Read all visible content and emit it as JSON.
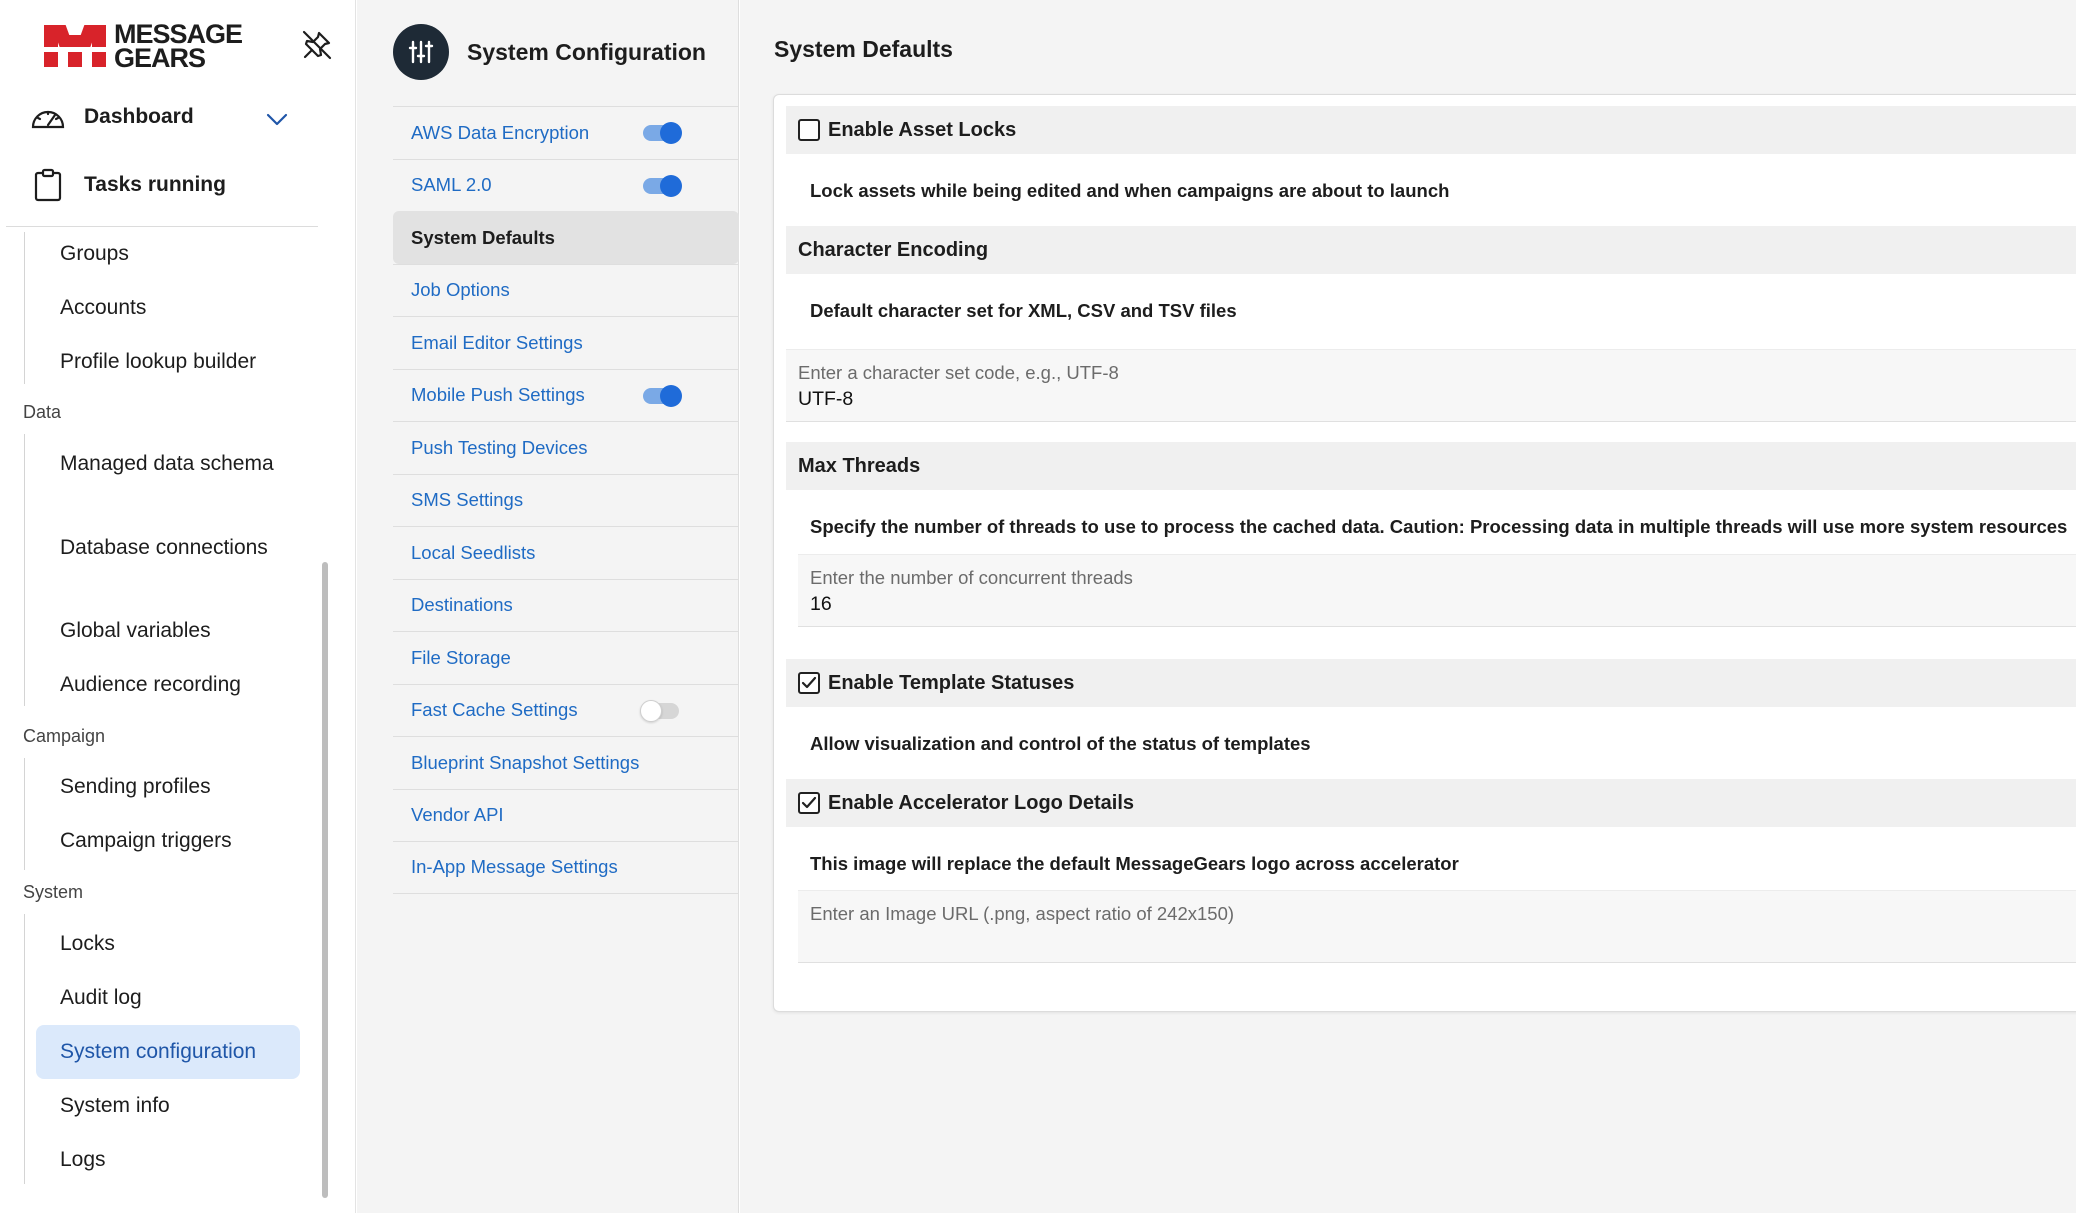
{
  "brand": {
    "line1": "MESSAGE",
    "line2": "GEARS",
    "color": "#d8232a"
  },
  "sidebar": {
    "dashboard_label": "Dashboard",
    "tasks_label": "Tasks running",
    "items_top": [
      "Groups",
      "Accounts",
      "Profile lookup builder"
    ],
    "section_data": "Data",
    "items_data": [
      "Managed data schema",
      "Database connections",
      "Global variables",
      "Audience recording"
    ],
    "section_campaign": "Campaign",
    "items_campaign": [
      "Sending profiles",
      "Campaign triggers"
    ],
    "section_system": "System",
    "items_system": [
      "Locks",
      "Audit log",
      "System configuration",
      "System info",
      "Logs"
    ],
    "active_item": "System configuration"
  },
  "config": {
    "title": "System Configuration",
    "items": [
      {
        "label": "AWS Data Encryption",
        "toggle": "on"
      },
      {
        "label": "SAML 2.0",
        "toggle": "on"
      },
      {
        "label": "System Defaults",
        "selected": true
      },
      {
        "label": "Job Options"
      },
      {
        "label": "Email Editor Settings"
      },
      {
        "label": "Mobile Push Settings",
        "toggle": "on"
      },
      {
        "label": "Push Testing Devices"
      },
      {
        "label": "SMS Settings"
      },
      {
        "label": "Local Seedlists"
      },
      {
        "label": "Destinations"
      },
      {
        "label": "File Storage"
      },
      {
        "label": "Fast Cache Settings",
        "toggle": "off"
      },
      {
        "label": "Blueprint Snapshot Settings"
      },
      {
        "label": "Vendor API"
      },
      {
        "label": "In-App Message Settings"
      }
    ]
  },
  "main": {
    "title": "System Defaults",
    "asset_locks": {
      "heading": "Enable Asset Locks",
      "checked": false,
      "description": "Lock assets while being edited and when campaigns are about to launch"
    },
    "char_encoding": {
      "heading": "Character Encoding",
      "description": "Default character set for XML, CSV and TSV files",
      "placeholder": "Enter a character set code, e.g., UTF-8",
      "value": "UTF-8"
    },
    "max_threads": {
      "heading": "Max Threads",
      "description": "Specify the number of threads to use to process the cached data. Caution: Processing data in multiple threads will use more system resources",
      "placeholder": "Enter the number of concurrent threads",
      "value": "16"
    },
    "template_statuses": {
      "heading": "Enable Template Statuses",
      "checked": true,
      "description": "Allow visualization and control of the status of templates"
    },
    "accelerator_logo": {
      "heading": "Enable Accelerator Logo Details",
      "checked": true,
      "description": "This image will replace the default MessageGears logo across accelerator",
      "placeholder": "Enter an Image URL (.png, aspect ratio of 242x150)"
    }
  },
  "colors": {
    "link": "#1f6bc4",
    "active_bg": "#dbe9fb",
    "toggle_on": "#1f6bd9"
  }
}
